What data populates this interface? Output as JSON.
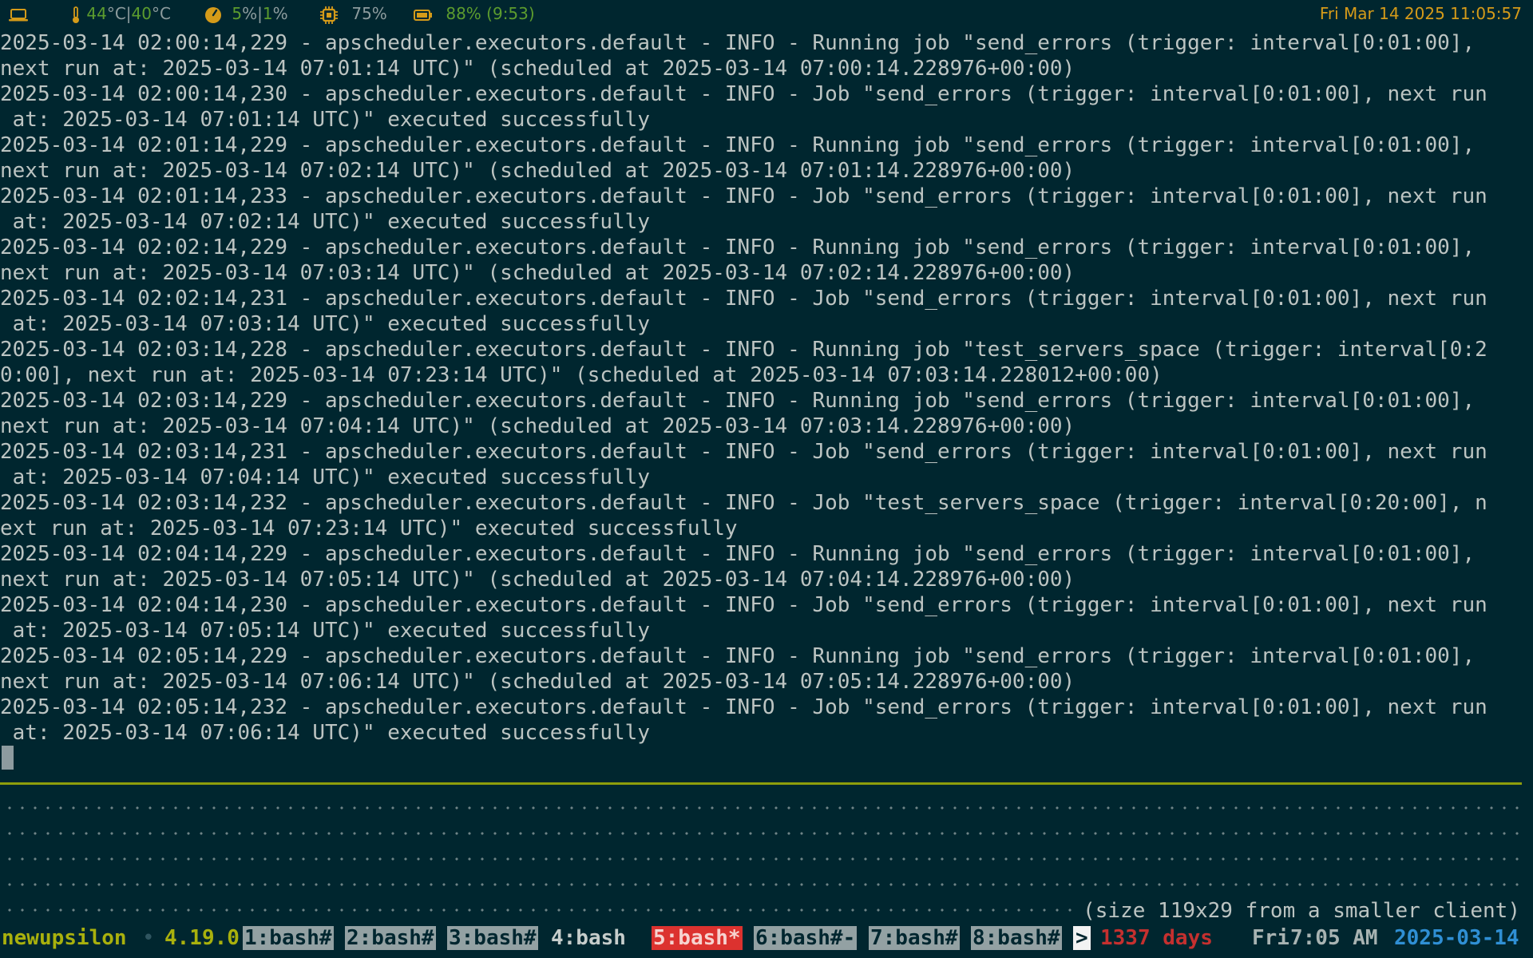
{
  "topbar": {
    "temp_cpu": "44",
    "temp_unit_1": "°C|",
    "temp_gpu": "40",
    "temp_unit_2": "°C",
    "cpu_usage": "5",
    "cpu_sep": "%|",
    "cpu_usage_2": "1",
    "cpu_unit": "%",
    "mem_usage": "75%",
    "battery": "88% (9:53)",
    "clock": "Fri Mar 14 2025 11:05:57",
    "icons": [
      "laptop-icon",
      "thermometer-icon",
      "gauge-icon",
      "chip-icon",
      "battery-icon"
    ],
    "colors": {
      "green": "#5c9c2e",
      "orange": "#d59b19"
    }
  },
  "terminal": {
    "lines": [
      "2025-03-14 02:00:14,229 - apscheduler.executors.default - INFO - Running job \"send_errors (trigger: interval[0:01:00],",
      "next run at: 2025-03-14 07:01:14 UTC)\" (scheduled at 2025-03-14 07:00:14.228976+00:00)",
      "2025-03-14 02:00:14,230 - apscheduler.executors.default - INFO - Job \"send_errors (trigger: interval[0:01:00], next run",
      " at: 2025-03-14 07:01:14 UTC)\" executed successfully",
      "2025-03-14 02:01:14,229 - apscheduler.executors.default - INFO - Running job \"send_errors (trigger: interval[0:01:00],",
      "next run at: 2025-03-14 07:02:14 UTC)\" (scheduled at 2025-03-14 07:01:14.228976+00:00)",
      "2025-03-14 02:01:14,233 - apscheduler.executors.default - INFO - Job \"send_errors (trigger: interval[0:01:00], next run",
      " at: 2025-03-14 07:02:14 UTC)\" executed successfully",
      "2025-03-14 02:02:14,229 - apscheduler.executors.default - INFO - Running job \"send_errors (trigger: interval[0:01:00],",
      "next run at: 2025-03-14 07:03:14 UTC)\" (scheduled at 2025-03-14 07:02:14.228976+00:00)",
      "2025-03-14 02:02:14,231 - apscheduler.executors.default - INFO - Job \"send_errors (trigger: interval[0:01:00], next run",
      " at: 2025-03-14 07:03:14 UTC)\" executed successfully",
      "2025-03-14 02:03:14,228 - apscheduler.executors.default - INFO - Running job \"test_servers_space (trigger: interval[0:2",
      "0:00], next run at: 2025-03-14 07:23:14 UTC)\" (scheduled at 2025-03-14 07:03:14.228012+00:00)",
      "2025-03-14 02:03:14,229 - apscheduler.executors.default - INFO - Running job \"send_errors (trigger: interval[0:01:00],",
      "next run at: 2025-03-14 07:04:14 UTC)\" (scheduled at 2025-03-14 07:03:14.228976+00:00)",
      "2025-03-14 02:03:14,231 - apscheduler.executors.default - INFO - Job \"send_errors (trigger: interval[0:01:00], next run",
      " at: 2025-03-14 07:04:14 UTC)\" executed successfully",
      "2025-03-14 02:03:14,232 - apscheduler.executors.default - INFO - Job \"test_servers_space (trigger: interval[0:20:00], n",
      "ext run at: 2025-03-14 07:23:14 UTC)\" executed successfully",
      "2025-03-14 02:04:14,229 - apscheduler.executors.default - INFO - Running job \"send_errors (trigger: interval[0:01:00],",
      "next run at: 2025-03-14 07:05:14 UTC)\" (scheduled at 2025-03-14 07:04:14.228976+00:00)",
      "2025-03-14 02:04:14,230 - apscheduler.executors.default - INFO - Job \"send_errors (trigger: interval[0:01:00], next run",
      " at: 2025-03-14 07:05:14 UTC)\" executed successfully",
      "2025-03-14 02:05:14,229 - apscheduler.executors.default - INFO - Running job \"send_errors (trigger: interval[0:01:00],",
      "next run at: 2025-03-14 07:06:14 UTC)\" (scheduled at 2025-03-14 07:05:14.228976+00:00)",
      "2025-03-14 02:05:14,232 - apscheduler.executors.default - INFO - Job \"send_errors (trigger: interval[0:01:00], next run",
      " at: 2025-03-14 07:06:14 UTC)\" executed successfully"
    ],
    "size_note": "(size 119x29 from a smaller client)"
  },
  "status": {
    "hostname": "newupsilon",
    "separator": "•",
    "kernel": "4.19.0",
    "windows": [
      {
        "label": "1:bash#",
        "style": "box"
      },
      {
        "label": "2:bash#",
        "style": "box"
      },
      {
        "label": "3:bash#",
        "style": "box"
      },
      {
        "label": "4:bash",
        "style": "plain"
      },
      {
        "label": "5:bash*",
        "style": "active"
      },
      {
        "label": "6:bash#-",
        "style": "box"
      },
      {
        "label": "7:bash#",
        "style": "box"
      },
      {
        "label": "8:bash#",
        "style": "box"
      }
    ],
    "prompt": ">",
    "uptime": "1337 days",
    "day": "Fri",
    "time": "7:05 AM",
    "date": "2025-03-14",
    "colors": {
      "active_window": "#dc322f",
      "accent": "#a9b10d",
      "date": "#2f8fd4"
    }
  }
}
